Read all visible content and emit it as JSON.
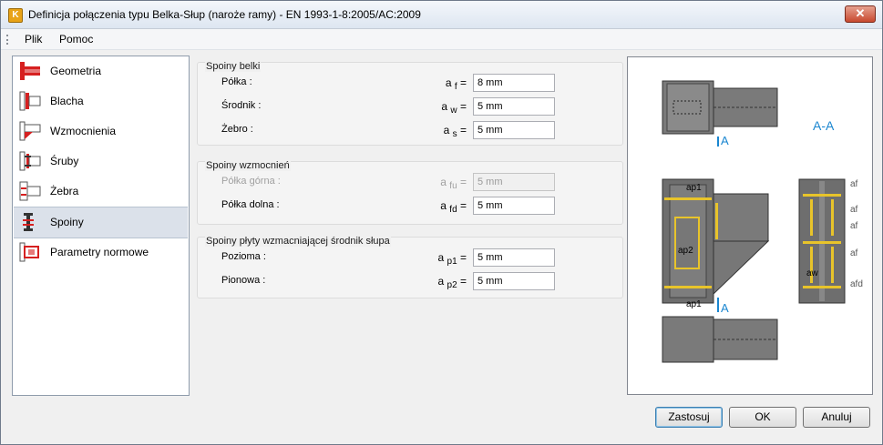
{
  "window": {
    "title": "Definicja połączenia typu Belka-Słup (naroże ramy) - EN 1993-1-8:2005/AC:2009",
    "app_icon_letter": "K",
    "close_glyph": "✕"
  },
  "menu": {
    "file": "Plik",
    "help": "Pomoc"
  },
  "sidebar": {
    "items": [
      {
        "label": "Geometria",
        "icon": "geometry-icon"
      },
      {
        "label": "Blacha",
        "icon": "plate-icon"
      },
      {
        "label": "Wzmocnienia",
        "icon": "stiffeners-icon"
      },
      {
        "label": "Śruby",
        "icon": "bolts-icon"
      },
      {
        "label": "Żebra",
        "icon": "ribs-icon"
      },
      {
        "label": "Spoiny",
        "icon": "welds-icon"
      },
      {
        "label": "Parametry normowe",
        "icon": "code-parameters-icon"
      }
    ],
    "selected": "Spoiny"
  },
  "beam_welds": {
    "title": "Spoiny belki",
    "rows": [
      {
        "label": "Półka :",
        "sym": "a",
        "sub": "f",
        "value": "8 mm"
      },
      {
        "label": "Środnik :",
        "sym": "a",
        "sub": "w",
        "value": "5 mm"
      },
      {
        "label": "Żebro :",
        "sym": "a",
        "sub": "s",
        "value": "5 mm"
      }
    ]
  },
  "reinforcement_welds": {
    "title": "Spoiny wzmocnień",
    "rows": [
      {
        "label": "Półka górna :",
        "sym": "a",
        "sub": "fu",
        "value": "5 mm",
        "disabled": true
      },
      {
        "label": "Półka dolna :",
        "sym": "a",
        "sub": "fd",
        "value": "5 mm",
        "disabled": false
      }
    ]
  },
  "web_plate_welds": {
    "title": "Spoiny płyty wzmacniającej środnik słupa",
    "rows": [
      {
        "label": "Pozioma :",
        "sym": "a",
        "sub": "p1",
        "value": "5 mm"
      },
      {
        "label": "Pionowa :",
        "sym": "a",
        "sub": "p2",
        "value": "5 mm"
      }
    ]
  },
  "eq": "=",
  "preview": {
    "section_title": "A-A",
    "section_marker": "A",
    "labels": [
      "ap1",
      "ap2",
      "ap1",
      "aw"
    ],
    "right_labels": [
      "af",
      "af",
      "af",
      "af",
      "afd"
    ]
  },
  "buttons": {
    "apply": "Zastosuj",
    "ok": "OK",
    "cancel": "Anuluj"
  },
  "colors": {
    "accent_blue": "#1a86d0",
    "weld_yellow": "#e8c42a",
    "steel_gray": "#6e6e6e",
    "red_icon": "#d62020"
  }
}
